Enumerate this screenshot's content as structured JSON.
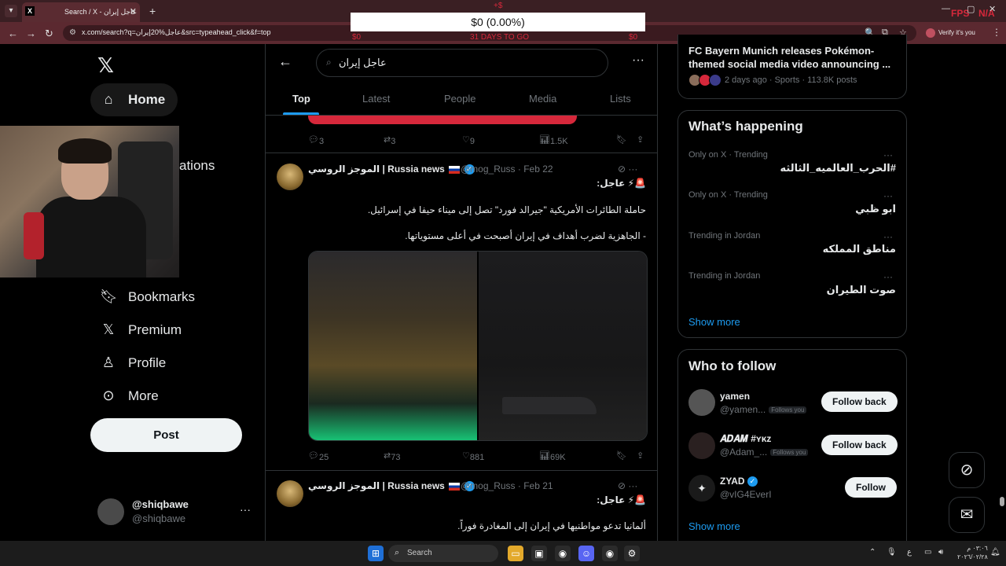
{
  "browser": {
    "tab_title": "Search / X - عاجل إيران",
    "tab_favicon": "X",
    "new_tab_symbol": "+",
    "url": "x.com/search?q=عاجل%20إيران&src=typeahead_click&f=top",
    "verify_label": "Verify it's you",
    "overlay_fps": "FPS",
    "overlay_na": "N/A"
  },
  "price_overlay": {
    "value": "$0 (0.00%)",
    "top_label": "+$",
    "left_label": "$0",
    "mid_label": "31 DAYS TO GO",
    "right_label": "$0"
  },
  "sidebar": {
    "items": [
      {
        "label": "Home",
        "icon": "home-icon"
      },
      {
        "label": "Notifications",
        "icon": "bell-icon",
        "visible_label": "ations"
      },
      {
        "label": "Bookmarks",
        "icon": "bookmark-icon"
      },
      {
        "label": "Premium",
        "icon": "x-premium-icon"
      },
      {
        "label": "Profile",
        "icon": "person-icon"
      },
      {
        "label": "More",
        "icon": "more-circle-icon"
      }
    ],
    "post_label": "Post",
    "account": {
      "name": "@shiqbawe",
      "handle": "@shiqbawe"
    }
  },
  "search": {
    "query": "عاجل إيران",
    "tabs": [
      "Top",
      "Latest",
      "People",
      "Media",
      "Lists"
    ],
    "active_tab": "Top"
  },
  "tweets": [
    {
      "replies": "3",
      "reposts": "3",
      "likes": "9",
      "views": "1.5K"
    },
    {
      "name": "الموجز الروسي | Russia news",
      "handle": "@mog_Russ",
      "date": "Feb 22",
      "header": "🚨⚡ عاجل:",
      "line1": "حاملة الطائرات الأمريكية \"جيرالد فورد\" تصل إلى ميناء حيفا في إسرائيل.",
      "line2": "- الجاهزية لضرب أهداف في إيران أصبحت في أعلى مستوياتها.",
      "replies": "25",
      "reposts": "73",
      "likes": "881",
      "views": "69K"
    },
    {
      "name": "الموجز الروسي | Russia news",
      "handle": "@mog_Russ",
      "date": "Feb 21",
      "header": "🚨⚡ عاجل:",
      "line1": "ألمانيا تدعو مواطنيها في إيران إلى المغادرة فوراً."
    }
  ],
  "news": {
    "title": "FC Bayern Munich releases Pokémon-themed social media video announcing ...",
    "meta": "2 days ago · Sports · 113.8K posts"
  },
  "whats_happening": {
    "title": "What’s happening",
    "trends": [
      {
        "context": "Only on X · Trending",
        "name": "#الحرب_العالميه_الثالثه"
      },
      {
        "context": "Only on X · Trending",
        "name": "ابو ظبي"
      },
      {
        "context": "Trending in Jordan",
        "name": "مناطق المملكه"
      },
      {
        "context": "Trending in Jordan",
        "name": "صوت الطيران"
      }
    ],
    "show_more": "Show more"
  },
  "who_to_follow": {
    "title": "Who to follow",
    "users": [
      {
        "name": "yamen",
        "handle": "@yamen...",
        "follows_you": "Follows you",
        "button": "Follow back"
      },
      {
        "name": "𝑨𝑫𝑨𝑴 #ʏᴋᴢ",
        "handle": "@Adam_...",
        "follows_you": "Follows you",
        "button": "Follow back"
      },
      {
        "name": "ZYAD",
        "handle": "@vIG4EverI",
        "follows_you": "",
        "button": "Follow"
      }
    ],
    "show_more": "Show more"
  },
  "taskbar": {
    "search_label": "Search",
    "clock_time": "٠٣:٠٦ م",
    "clock_date": "٢٠٢٦/٠٢/٢٨",
    "lang": "ع"
  }
}
